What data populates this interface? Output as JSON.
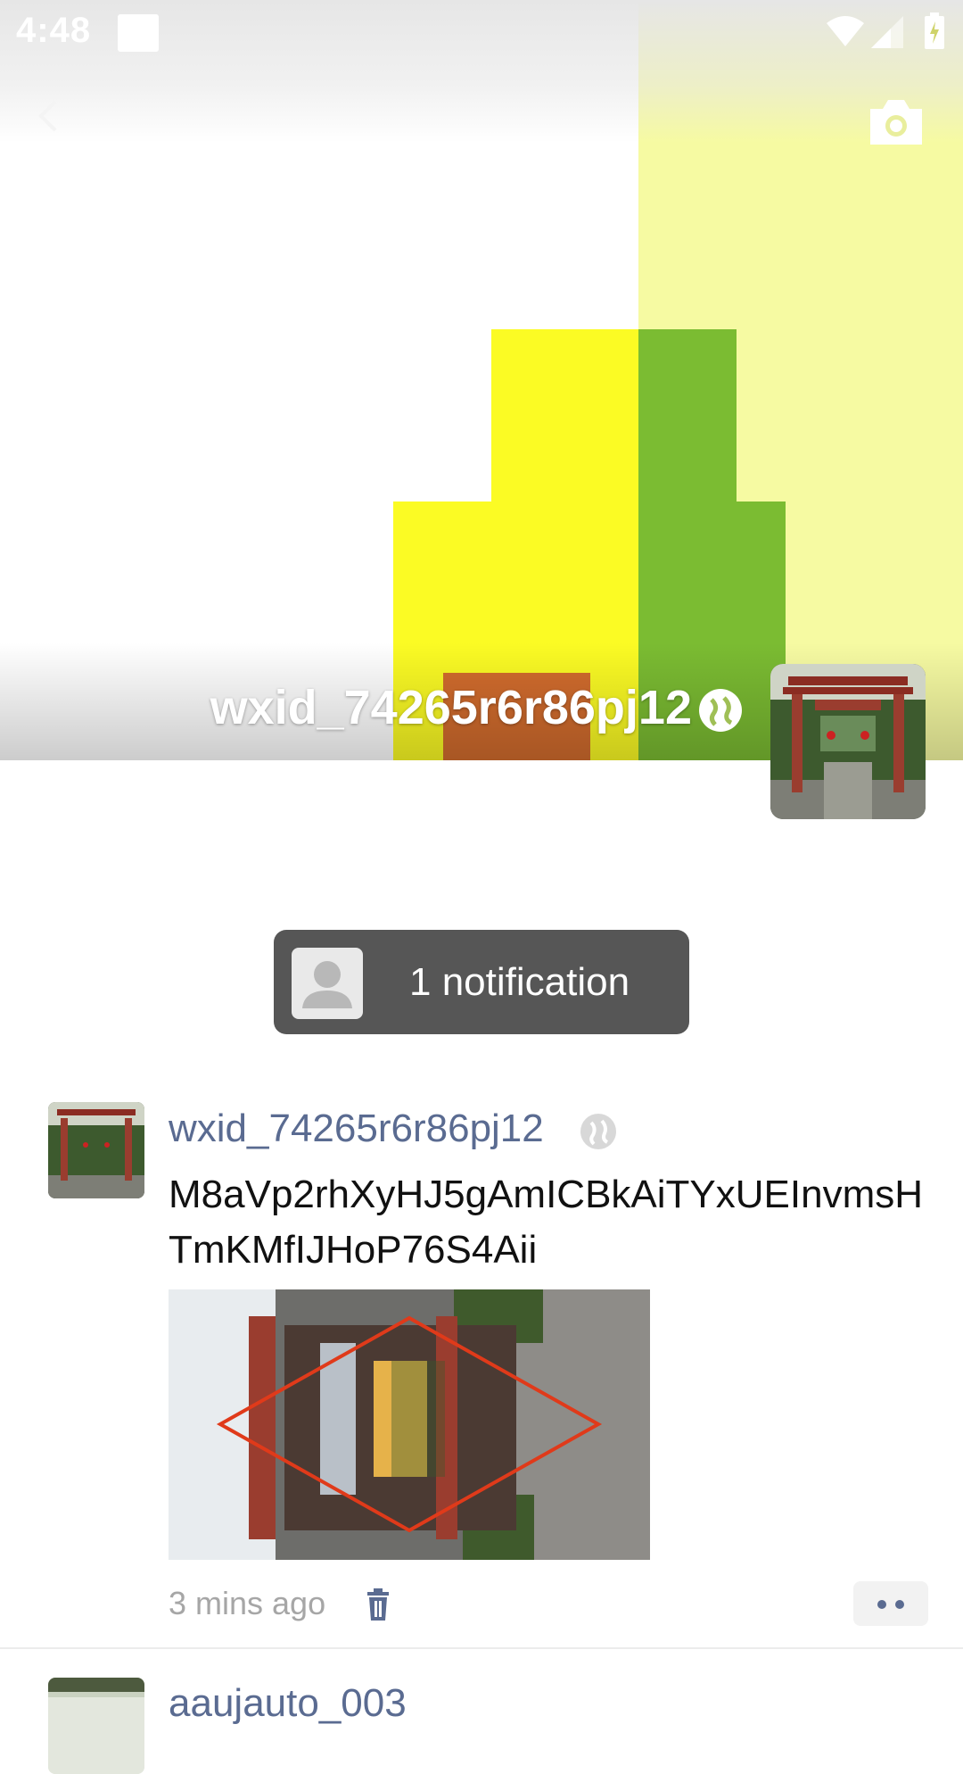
{
  "status_bar": {
    "time": "4:48"
  },
  "toolbar": {
    "back_icon": "chevron-left-icon",
    "camera_icon": "camera-icon"
  },
  "profile": {
    "name": "wxid_74265r6r86pj12",
    "badge_icon": "friends-circle-badge-icon"
  },
  "notification": {
    "label": "1 notification"
  },
  "posts": [
    {
      "author": "wxid_74265r6r86pj12",
      "text": "M8aVp2rhXyHJ5gAmICBkAiTYxUEInvmsHTmKMfIJHoP76S4Aii",
      "time": "3 mins ago",
      "delete_icon": "trash-icon",
      "more_icon": "more-dots-icon"
    },
    {
      "author": "aaujauto_003"
    }
  ],
  "colors": {
    "name_blue": "#5a6b91",
    "cover_yellow": "#fbfb24",
    "cover_green": "#7bbc32",
    "cover_orange": "#d26c2d",
    "cover_pale_yellow": "#f6faa2",
    "pill_gray": "#565656"
  }
}
